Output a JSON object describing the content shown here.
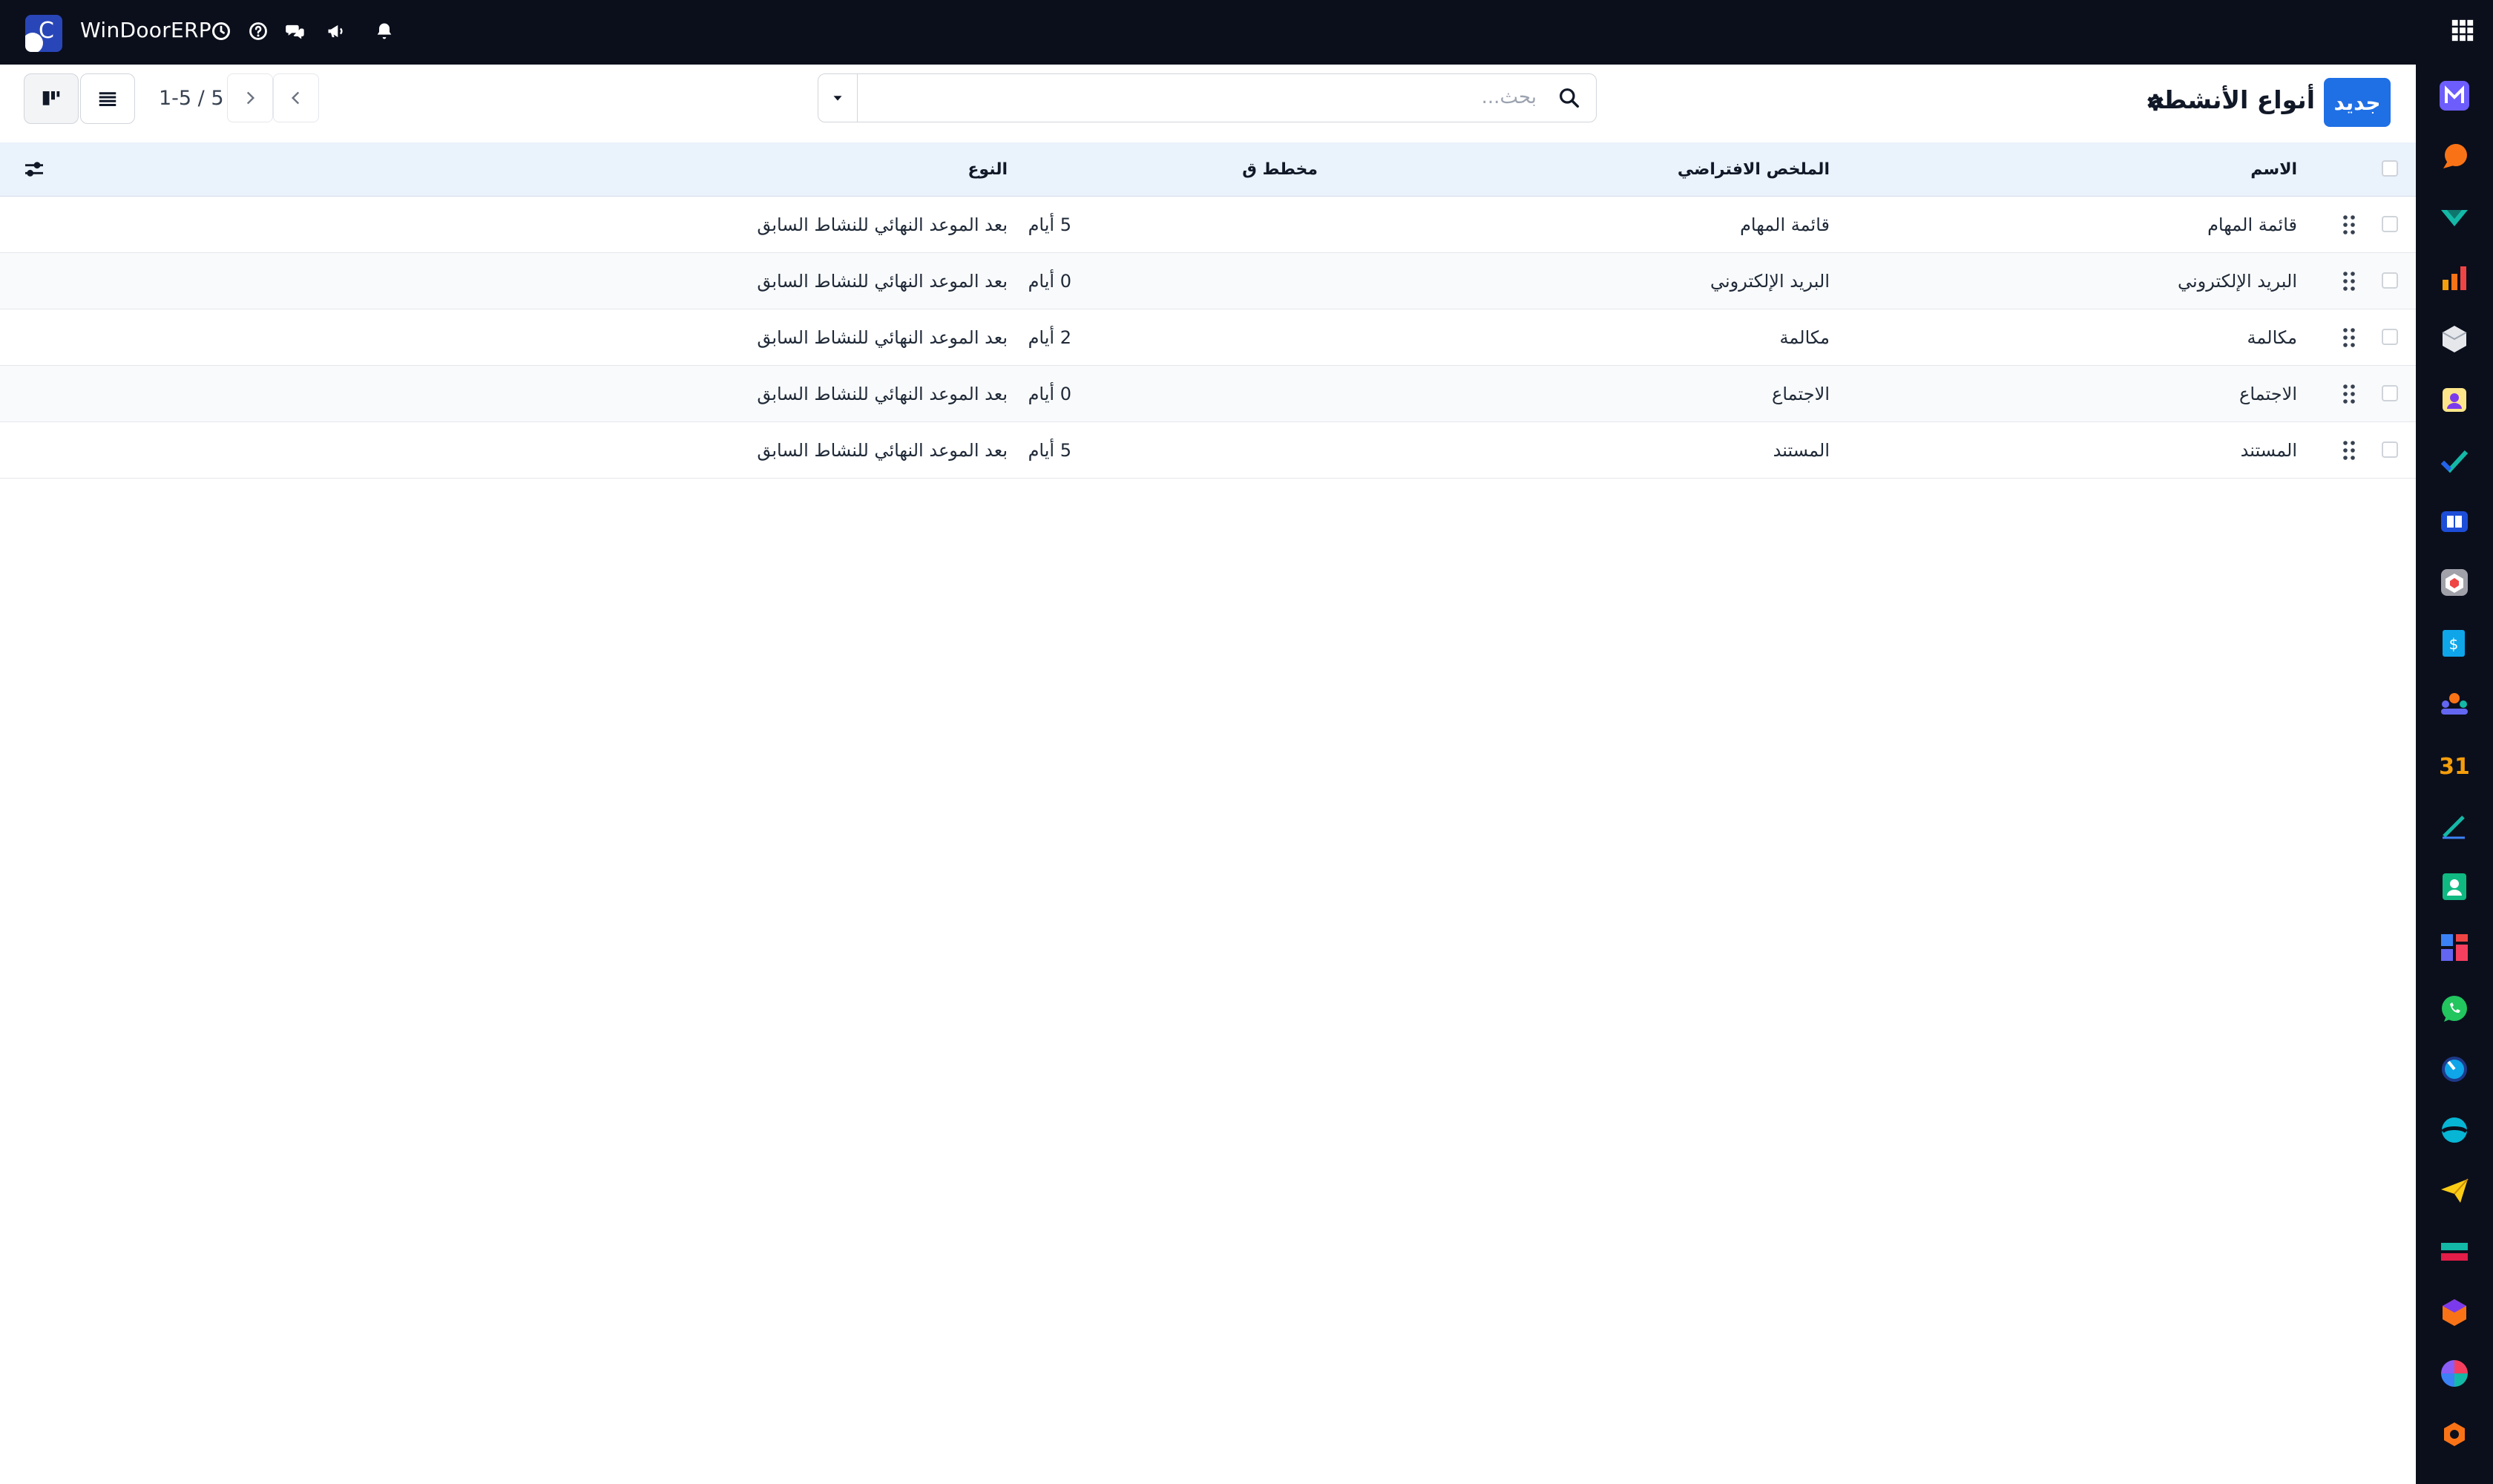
{
  "navbar": {
    "app_title": "WinDoorERP",
    "icons": [
      "clock-icon",
      "help-icon",
      "chat-icon",
      "megaphone-icon",
      "bell-icon",
      "apps-grid-icon"
    ]
  },
  "control_panel": {
    "new_button": "جديد",
    "page_title": "أنواع الأنشطة",
    "search_placeholder": "بحث...",
    "pager": "1-5 / 5"
  },
  "table": {
    "columns": {
      "name": "الاسم",
      "default_summary": "الملخص الافتراضي",
      "planned_in": "مخطط ق",
      "type": "النوع"
    },
    "rows": [
      {
        "name": "قائمة المهام",
        "summary": "قائمة المهام",
        "planned": "5 أيام",
        "type": "بعد الموعد النهائي للنشاط السابق"
      },
      {
        "name": "البريد الإلكتروني",
        "summary": "البريد الإلكتروني",
        "planned": "0 أيام",
        "type": "بعد الموعد النهائي للنشاط السابق"
      },
      {
        "name": "مكالمة",
        "summary": "مكالمة",
        "planned": "2 أيام",
        "type": "بعد الموعد النهائي للنشاط السابق"
      },
      {
        "name": "الاجتماع",
        "summary": "الاجتماع",
        "planned": "0 أيام",
        "type": "بعد الموعد النهائي للنشاط السابق"
      },
      {
        "name": "المستند",
        "summary": "المستند",
        "planned": "5 أيام",
        "type": "بعد الموعد النهائي للنشاط السابق"
      }
    ]
  },
  "rail_apps": [
    "mail-icon",
    "discuss-icon",
    "crm-icon",
    "sales-icon",
    "inventory-icon",
    "employees-icon",
    "project-icon",
    "knowledge-icon",
    "website-icon",
    "accounting-icon",
    "contacts-icon",
    "calendar-icon",
    "sign-icon",
    "appraisal-icon",
    "dashboard-icon",
    "whatsapp-icon",
    "planning-icon",
    "helpdesk-icon",
    "email-marketing-icon",
    "spreadsheet-icon",
    "studio-icon",
    "documents-icon",
    "settings-icon"
  ],
  "colors": {
    "navbar_bg": "#0b0f1c",
    "primary": "#1f6fe5",
    "header_bg": "#eaf2fc"
  }
}
